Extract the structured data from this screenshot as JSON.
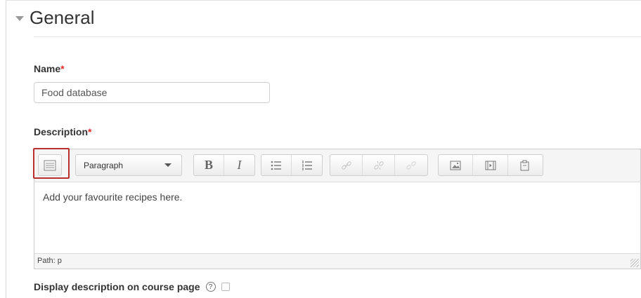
{
  "section": {
    "title": "General"
  },
  "name": {
    "label": "Name",
    "required_marker": "*",
    "value": "Food database"
  },
  "description": {
    "label": "Description",
    "required_marker": "*",
    "format_select": "Paragraph",
    "content": "Add your favourite recipes here.",
    "path": "Path: p"
  },
  "toolbar": {
    "bold": "B",
    "italic": "I",
    "buttons": [
      "toolbar-toggle-icon",
      "bold-icon",
      "italic-icon",
      "unordered-list-icon",
      "ordered-list-icon",
      "link-icon",
      "unlink-icon",
      "anchor-icon",
      "image-icon",
      "media-icon",
      "manage-files-icon"
    ]
  },
  "display": {
    "label": "Display description on course page",
    "help": "?",
    "checked": false
  },
  "colors": {
    "required": "#e32d2d",
    "highlight_box": "#b7302f"
  }
}
